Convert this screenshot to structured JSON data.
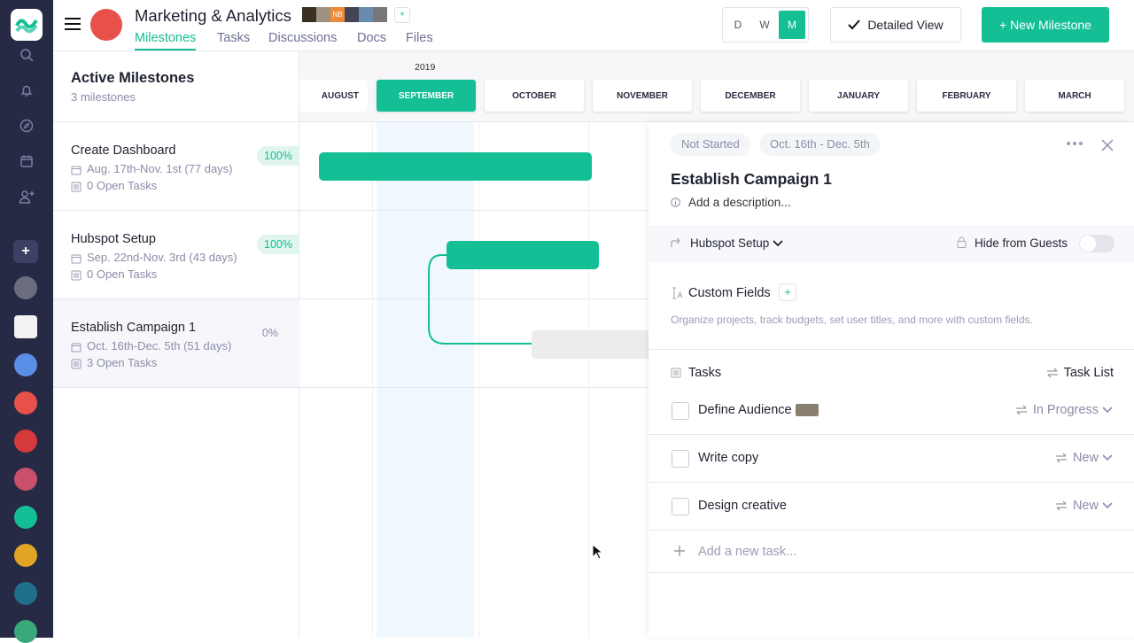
{
  "colors": {
    "accent": "#14bf96",
    "rail": "#262a45"
  },
  "project": {
    "title": "Marketing & Analytics",
    "avatars": [
      "",
      "",
      "NB",
      "",
      "",
      ""
    ]
  },
  "nav": {
    "tabs": [
      "Milestones",
      "Tasks",
      "Discussions",
      "Docs",
      "Files"
    ],
    "active": "Milestones"
  },
  "toolbar": {
    "scale": [
      "D",
      "W",
      "M"
    ],
    "active_scale": "M",
    "detailed_view": "Detailed View",
    "new_milestone": "+ New Milestone"
  },
  "left": {
    "title": "Active Milestones",
    "count": "3 milestones",
    "milestones": [
      {
        "name": "Create Dashboard",
        "dates": "Aug. 17th-Nov. 1st (77 days)",
        "tasks": "0 Open Tasks",
        "pct": "100%"
      },
      {
        "name": "Hubspot Setup",
        "dates": "Sep. 22nd-Nov. 3rd (43 days)",
        "tasks": "0 Open Tasks",
        "pct": "100%"
      },
      {
        "name": "Establish Campaign 1",
        "dates": "Oct. 16th-Dec. 5th (51 days)",
        "tasks": "3 Open Tasks",
        "pct": "0%"
      }
    ]
  },
  "timeline": {
    "year": "2019",
    "months": [
      "AUGUST",
      "SEPTEMBER",
      "OCTOBER",
      "NOVEMBER",
      "DECEMBER",
      "JANUARY",
      "FEBRUARY",
      "MARCH"
    ],
    "active_month": "SEPTEMBER"
  },
  "panel": {
    "status": "Not Started",
    "range": "Oct. 16th - Dec. 5th",
    "title": "Establish Campaign 1",
    "description_placeholder": "Add a description...",
    "dependency": "Hubspot Setup",
    "hide_guests": "Hide from Guests",
    "hide_guests_on": false,
    "custom_fields": "Custom Fields",
    "custom_fields_hint": "Organize projects, track budgets, set user titles, and more with custom fields.",
    "tasks_label": "Tasks",
    "task_list": "Task List",
    "tasks": [
      {
        "name": "Define Audience",
        "status": "In Progress"
      },
      {
        "name": "Write copy",
        "status": "New"
      },
      {
        "name": "Design creative",
        "status": "New"
      }
    ],
    "add_task": "Add a new task..."
  }
}
